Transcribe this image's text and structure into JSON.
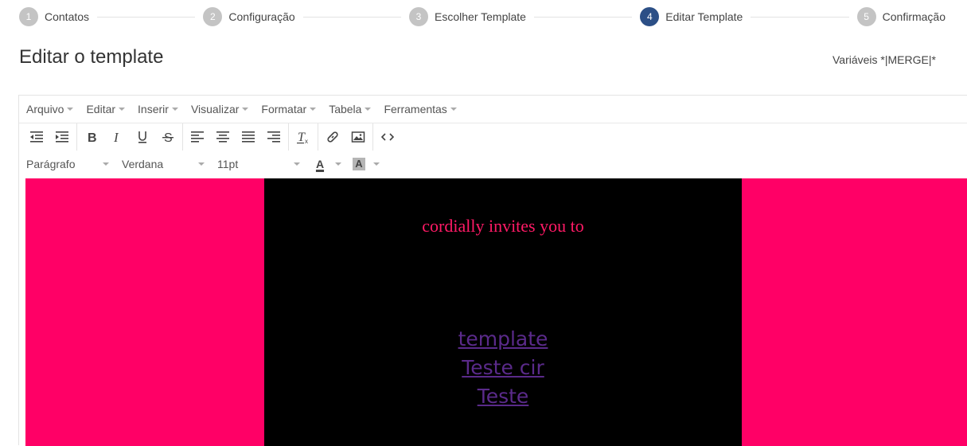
{
  "stepper": {
    "steps": [
      {
        "num": "1",
        "label": "Contatos"
      },
      {
        "num": "2",
        "label": "Configuração"
      },
      {
        "num": "3",
        "label": "Escolher Template"
      },
      {
        "num": "4",
        "label": "Editar Template"
      },
      {
        "num": "5",
        "label": "Confirmação"
      }
    ],
    "active_step": 4
  },
  "header": {
    "title": "Editar o template",
    "merge_vars": "Variáveis *|MERGE|*"
  },
  "editor": {
    "menu": [
      "Arquivo",
      "Editar",
      "Inserir",
      "Visualizar",
      "Formatar",
      "Tabela",
      "Ferramentas"
    ],
    "toolbar_icons": [
      "outdent-icon",
      "indent-icon",
      "bold-icon",
      "italic-icon",
      "underline-icon",
      "strikethrough-icon",
      "align-left-icon",
      "align-center-icon",
      "align-justify-icon",
      "align-right-icon",
      "clear-format-icon",
      "link-icon",
      "image-icon",
      "source-code-icon"
    ],
    "block_format": "Parágrafo",
    "font_family": "Verdana",
    "font_size": "11pt",
    "text_color_label": "A",
    "bg_color_label": "A",
    "content": {
      "invite_text": "cordially invites you to",
      "links": [
        "template",
        "Teste cir",
        "Teste"
      ],
      "outer_color": "#ff0066",
      "panel_color": "#000000",
      "invite_color": "#ff1a66",
      "link_color": "#5a2a8a"
    }
  }
}
